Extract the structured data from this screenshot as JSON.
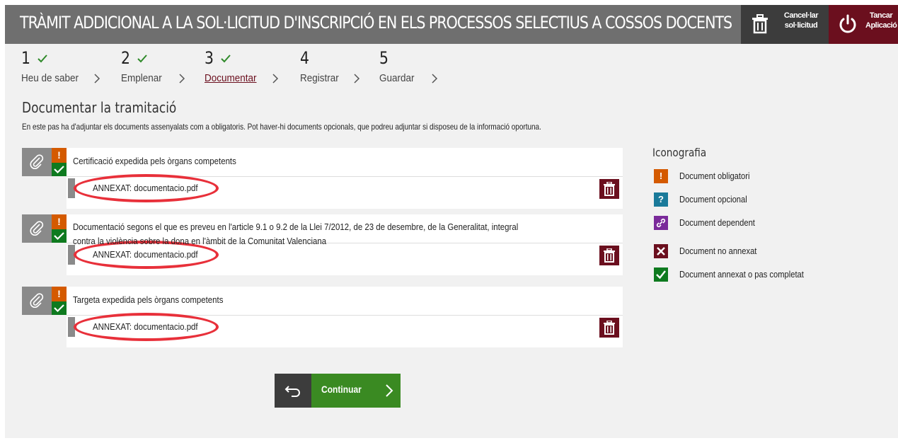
{
  "header": {
    "title": "TRÀMIT ADDICIONAL A LA SOL·LICITUD D'INSCRIPCIÓ EN ELS PROCESSOS SELECTIUS A COSSOS DOCENTS",
    "cancel": {
      "line1": "Cancel·lar",
      "line2": "sol·licitud",
      "icon": "trash-icon"
    },
    "close": {
      "line1": "Tancar",
      "line2": "Aplicació",
      "icon": "power-icon"
    },
    "colors": {
      "header_bg": "#6f6f6f",
      "cancel_bg": "#3c3c3c",
      "close_bg": "#6b0f1e"
    }
  },
  "steps": [
    {
      "number": "1",
      "label": "Heu de saber",
      "completed": true,
      "active": false
    },
    {
      "number": "2",
      "label": "Emplenar",
      "completed": true,
      "active": false
    },
    {
      "number": "3",
      "label": "Documentar",
      "completed": true,
      "active": true
    },
    {
      "number": "4",
      "label": "Registrar",
      "completed": false,
      "active": false
    },
    {
      "number": "5",
      "label": "Guardar",
      "completed": false,
      "active": false
    }
  ],
  "section": {
    "title": "Documentar la tramitació",
    "description": "En este pas ha d'adjuntar els documents assenyalats com a obligatoris. Pot haver-hi documents opcionals, que podreu adjuntar si disposeu de la informació oportuna."
  },
  "documents": [
    {
      "title": "Certificació expedida pels òrgans competents",
      "title_line2": "",
      "obligatory_mark": "!",
      "attachment_label": "ANNEXAT:",
      "attachment_file": "documentacio.pdf"
    },
    {
      "title": "Documentació segons el que es preveu en l'article 9.1 o 9.2 de la Llei 7/2012, de 23 de desembre, de la Generalitat, integral",
      "title_line2": "contra la violència sobre la dona en l'àmbit de la Comunitat Valenciana",
      "obligatory_mark": "!",
      "attachment_label": "ANNEXAT:",
      "attachment_file": "documentacio.pdf"
    },
    {
      "title": "Targeta expedida pels òrgans competents",
      "title_line2": "",
      "obligatory_mark": "!",
      "attachment_label": "ANNEXAT:",
      "attachment_file": "documentacio.pdf"
    }
  ],
  "legend": {
    "title": "Iconografia",
    "items": [
      {
        "label": "Document obligatori",
        "symbol": "!",
        "color": "#d45a00",
        "icon": "exclamation-icon"
      },
      {
        "label": "Document opcional",
        "symbol": "?",
        "color": "#1a7a9a",
        "icon": "question-icon"
      },
      {
        "label": "Document dependent",
        "symbol": "",
        "color": "#7a2a9a",
        "icon": "link-icon"
      },
      {
        "label": "Document no annexat",
        "symbol": "",
        "color": "#6b0f1e",
        "icon": "cross-icon"
      },
      {
        "label": "Document annexat o pas completat",
        "symbol": "",
        "color": "#0e7a1f",
        "icon": "check-icon"
      }
    ]
  },
  "actions": {
    "back_icon": "return-arrow-icon",
    "continue_label": "Continuar",
    "continue_icon": "chevron-right-icon",
    "continue_color": "#3a8a22"
  }
}
